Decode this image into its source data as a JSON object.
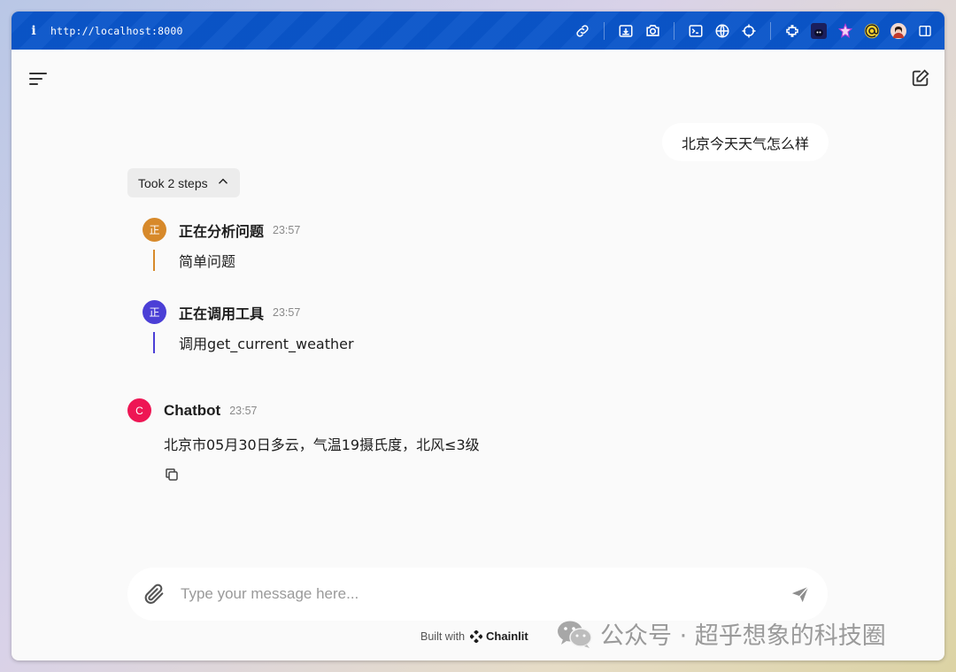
{
  "browser": {
    "info_glyph": "i",
    "url": "http://localhost:8000",
    "icons": [
      "link-icon",
      "save-page-icon",
      "screenshot-icon",
      "terminal-icon",
      "globe-icon",
      "crosshair-icon",
      "extensions-icon",
      "ghost-extension-icon",
      "star-extension-icon",
      "at-extension-icon",
      "profile-avatar",
      "sidebar-toggle-icon"
    ]
  },
  "chat": {
    "user_message": "北京今天天气怎么样",
    "steps_label": "Took 2 steps",
    "steps": [
      {
        "avatar": "正",
        "title": "正在分析问题",
        "time": "23:57",
        "body": "简单问题",
        "color": "#d7892a"
      },
      {
        "avatar": "正",
        "title": "正在调用工具",
        "time": "23:57",
        "body": "调用get_current_weather",
        "color": "#4b3fd6"
      }
    ],
    "bot": {
      "avatar": "C",
      "name": "Chatbot",
      "time": "23:57",
      "message": "北京市05月30日多云，气温19摄氏度，北风≤3级"
    }
  },
  "composer": {
    "placeholder": "Type your message here..."
  },
  "footer": {
    "built_with": "Built with",
    "brand": "Chainlit"
  },
  "watermark": {
    "text": "公众号 · 超乎想象的科技圈"
  },
  "colors": {
    "browser_bar": "#0a55c9",
    "bot_avatar": "#ee1654",
    "background": "#fafafa"
  }
}
